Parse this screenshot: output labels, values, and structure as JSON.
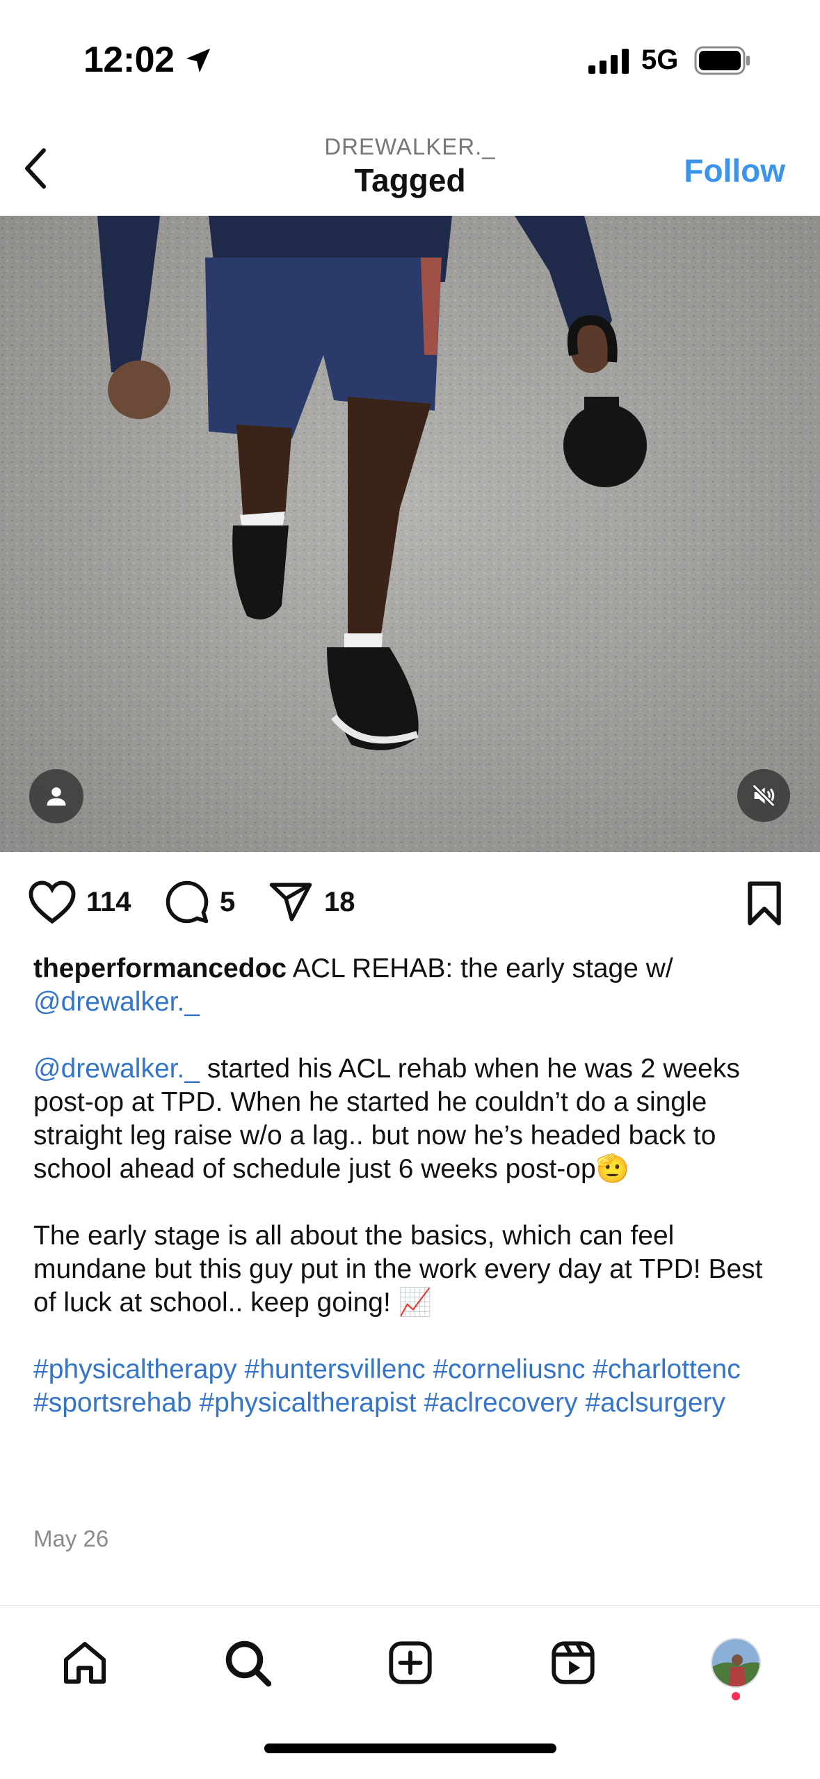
{
  "status_bar": {
    "time": "12:02",
    "network": "5G"
  },
  "header": {
    "username": "DREWALKER._",
    "title": "Tagged",
    "follow_label": "Follow"
  },
  "post": {
    "likes": "114",
    "comments": "5",
    "shares": "18",
    "caption": {
      "username": "theperformancedoc",
      "intro": "ACL REHAB: the early stage w/",
      "intro_mention": "@drewalker._",
      "para1_mention": "@drewalker._",
      "para1_text": "started his ACL rehab when he was 2 weeks post-op at TPD. When he started he couldn’t do a single straight leg raise w/o a lag.. but now he’s headed back to school ahead of schedule just 6 weeks post-op🫡",
      "para2_text": "The early stage is all about the basics, which can feel mundane but this guy put in the work every day at TPD! Best of luck at school.. keep going! 📈",
      "hashtags": "#physicaltherapy #huntersvillenc #corneliusnc #charlottenc #sportsrehab #physicaltherapist #aclrecovery #aclsurgery"
    },
    "date": "May 26"
  },
  "icons": {
    "back": "chevron-left-icon",
    "like": "heart-icon",
    "comment": "comment-bubble-icon",
    "share": "paper-plane-icon",
    "save": "bookmark-icon",
    "tag": "person-icon",
    "mute": "speaker-muted-icon",
    "nav": [
      "home-icon",
      "search-icon",
      "create-plus-icon",
      "reels-icon",
      "profile-avatar"
    ]
  },
  "colors": {
    "accent": "#3b94ec",
    "link": "#3475c9",
    "notification": "#ff2d55"
  }
}
